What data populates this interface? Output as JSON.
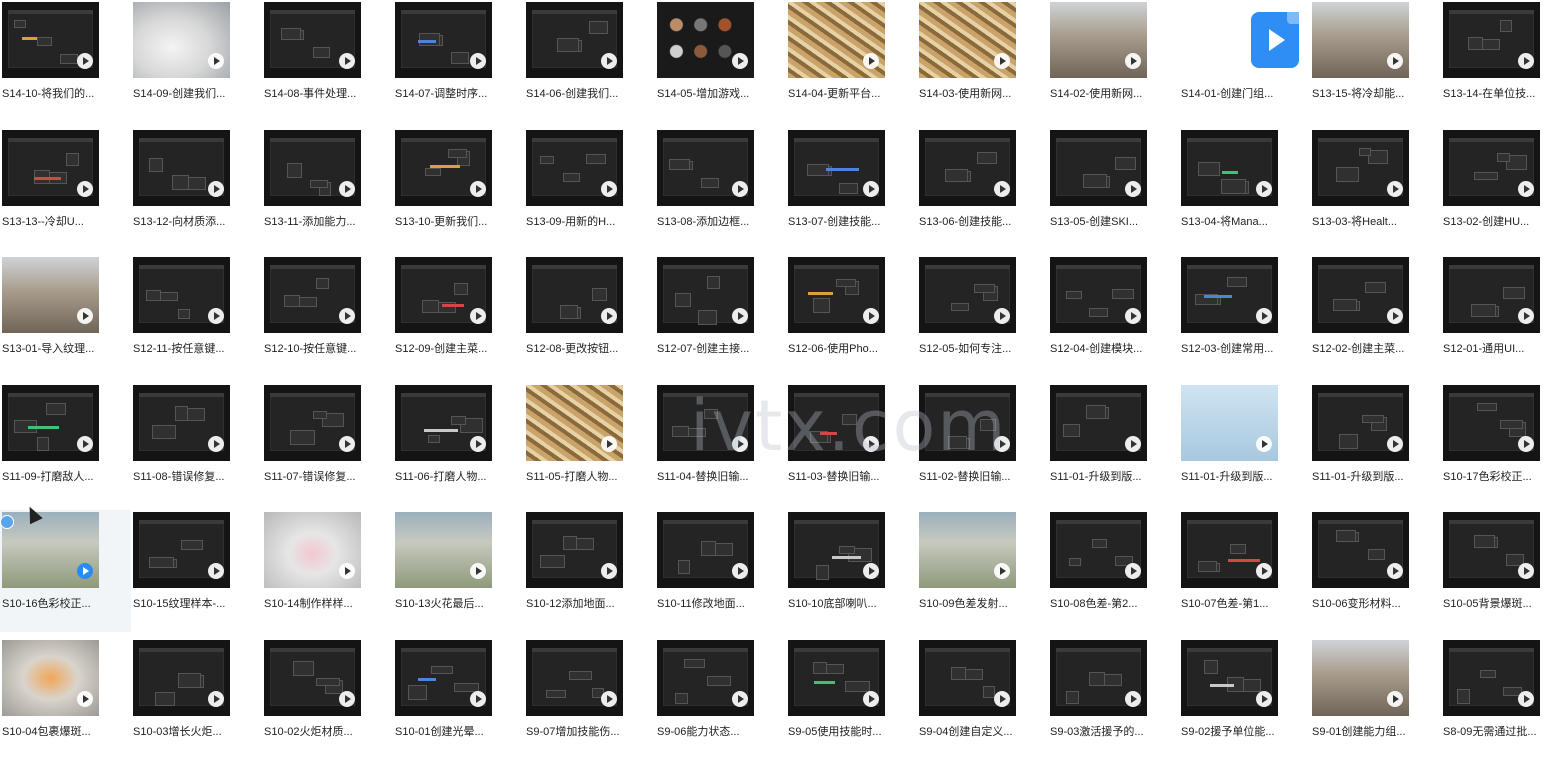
{
  "watermark": "ivtx.com",
  "rows": [
    [
      "S14-10-将我们的...",
      "S14-09-创建我们...",
      "S14-08-事件处理...",
      "S14-07-调整时序...",
      "S14-06-创建我们...",
      "S14-05-增加游戏...",
      "S14-04-更新平台...",
      "S14-03-使用新网...",
      "S14-02-使用新网...",
      "S14-01-创建门组...",
      "S13-15-将冷却能...",
      "S13-14-在单位技..."
    ],
    [
      "S13-13--冷却U...",
      "S13-12-向材质添...",
      "S13-11-添加能力...",
      "S13-10-更新我们...",
      "S13-09-用新的H...",
      "S13-08-添加边框...",
      "S13-07-创建技能...",
      "S13-06-创建技能...",
      "S13-05-创建SKI...",
      "S13-04-将Mana...",
      "S13-03-将Healt...",
      "S13-02-创建HU..."
    ],
    [
      "S13-01-导入纹理...",
      "S12-11-按任意键...",
      "S12-10-按任意键...",
      "S12-09-创建主菜...",
      "S12-08-更改按钮...",
      "S12-07-创建主接...",
      "S12-06-使用Pho...",
      "S12-05-如何专注...",
      "S12-04-创建模块...",
      "S12-03-创建常用...",
      "S12-02-创建主菜...",
      "S12-01-通用UI..."
    ],
    [
      "S11-09-打磨敌人...",
      "S11-08-错误修复...",
      "S11-07-错误修复...",
      "S11-06-打磨人物...",
      "S11-05-打磨人物...",
      "S11-04-替换旧输...",
      "S11-03-替换旧输...",
      "S11-02-替换旧输...",
      "S11-01-升级到版...",
      "S11-01-升级到版...",
      "S11-01-升级到版...",
      "S10-17色彩校正..."
    ],
    [
      "S10-16色彩校正...",
      "S10-15纹理样本-...",
      "S10-14制作样样...",
      "S10-13火花最后...",
      "S10-12添加地面...",
      "S10-11修改地面...",
      "S10-10底部喇叭...",
      "S10-09色差发射...",
      "S10-08色差-第2...",
      "S10-07色差-第1...",
      "S10-06变形材料...",
      "S10-05背景爆斑..."
    ],
    [
      "S10-04包裹爆斑...",
      "S10-03增长火炬...",
      "S10-02火炬材质...",
      "S10-01创建光晕...",
      "S9-07增加技能伤...",
      "S9-06能力状态...",
      "S9-05使用技能时...",
      "S9-04创建自定义...",
      "S9-03激活援予的...",
      "S9-02援予单位能...",
      "S9-01创建能力组...",
      "S8-09无需通过批..."
    ]
  ],
  "thumb_kinds": [
    [
      "editor",
      "photo-white",
      "editor",
      "editor",
      "editor",
      "spheres",
      "photo-wood",
      "photo-wood",
      "photo-ruins",
      "app-icon",
      "photo-ruins",
      "editor"
    ],
    [
      "editor",
      "editor",
      "editor",
      "editor",
      "editor",
      "editor",
      "editor",
      "editor",
      "editor",
      "editor",
      "editor",
      "editor"
    ],
    [
      "photo-ruins",
      "editor",
      "editor",
      "editor",
      "editor",
      "editor",
      "editor",
      "editor",
      "editor",
      "editor",
      "editor",
      "editor"
    ],
    [
      "editor",
      "editor",
      "editor",
      "editor",
      "photo-wood",
      "editor",
      "editor",
      "editor",
      "editor",
      "photo-sky",
      "editor",
      "editor"
    ],
    [
      "photo-field",
      "editor",
      "photo-pink",
      "photo-field",
      "editor",
      "editor",
      "editor",
      "photo-field",
      "editor",
      "editor",
      "editor",
      "editor"
    ],
    [
      "photo-fire",
      "editor",
      "editor",
      "editor",
      "editor",
      "editor",
      "editor",
      "editor",
      "editor",
      "editor",
      "photo-ruins",
      "editor"
    ]
  ],
  "selected": {
    "row": 4,
    "col": 0
  }
}
